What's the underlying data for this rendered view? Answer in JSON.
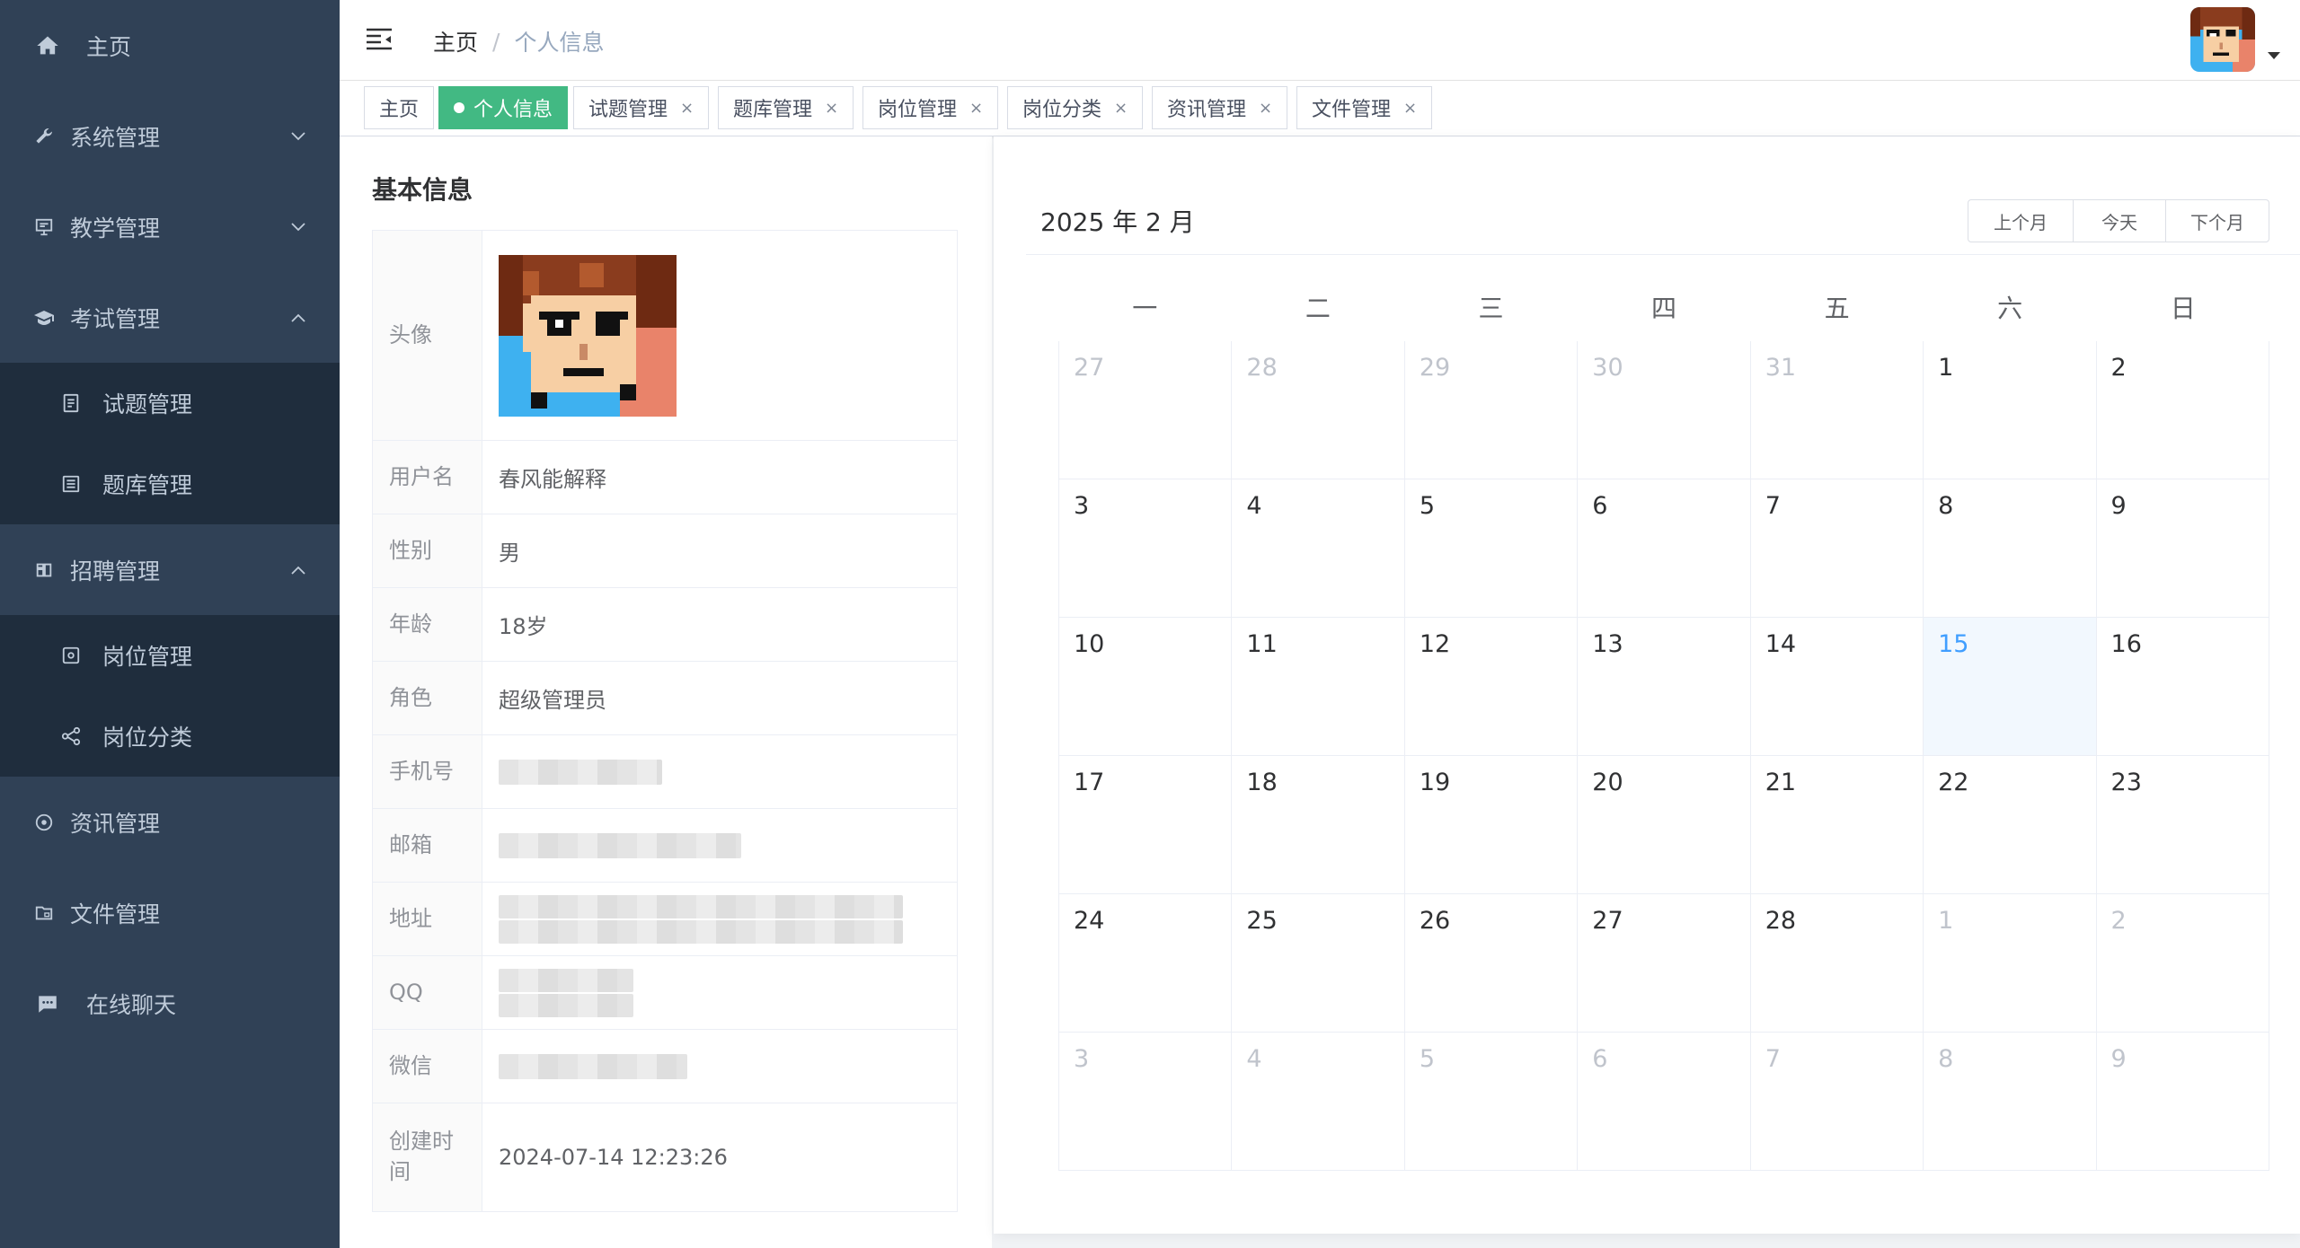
{
  "sidebar": {
    "home": "主页",
    "system": "系统管理",
    "teaching": "教学管理",
    "exam": "考试管理",
    "exam_sub": [
      "试题管理",
      "题库管理"
    ],
    "recruit": "招聘管理",
    "recruit_sub": [
      "岗位管理",
      "岗位分类"
    ],
    "news": "资讯管理",
    "files": "文件管理",
    "chat": "在线聊天"
  },
  "header": {
    "breadcrumb_home": "主页",
    "breadcrumb_sep": "/",
    "breadcrumb_current": "个人信息"
  },
  "tags": [
    {
      "label": "主页",
      "active": false,
      "closable": false
    },
    {
      "label": "个人信息",
      "active": true,
      "closable": false
    },
    {
      "label": "试题管理",
      "active": false,
      "closable": true
    },
    {
      "label": "题库管理",
      "active": false,
      "closable": true
    },
    {
      "label": "岗位管理",
      "active": false,
      "closable": true
    },
    {
      "label": "岗位分类",
      "active": false,
      "closable": true
    },
    {
      "label": "资讯管理",
      "active": false,
      "closable": true
    },
    {
      "label": "文件管理",
      "active": false,
      "closable": true
    }
  ],
  "tag_close_glyph": "×",
  "profile": {
    "title": "基本信息",
    "labels": {
      "avatar": "头像",
      "username": "用户名",
      "gender": "性别",
      "age": "年龄",
      "role": "角色",
      "phone": "手机号",
      "email": "邮箱",
      "address": "地址",
      "qq": "QQ",
      "wechat": "微信",
      "created": "创建时间"
    },
    "values": {
      "username": "春风能解释",
      "gender": "男",
      "age": "18岁",
      "role": "超级管理员",
      "created": "2024-07-14 12:23:26"
    }
  },
  "calendar": {
    "title": "2025 年 2 月",
    "prev": "上个月",
    "today": "今天",
    "next": "下个月",
    "weekdays": [
      "一",
      "二",
      "三",
      "四",
      "五",
      "六",
      "日"
    ],
    "weeks": [
      [
        {
          "d": "27",
          "o": true
        },
        {
          "d": "28",
          "o": true
        },
        {
          "d": "29",
          "o": true
        },
        {
          "d": "30",
          "o": true
        },
        {
          "d": "31",
          "o": true
        },
        {
          "d": "1"
        },
        {
          "d": "2"
        }
      ],
      [
        {
          "d": "3"
        },
        {
          "d": "4"
        },
        {
          "d": "5"
        },
        {
          "d": "6"
        },
        {
          "d": "7"
        },
        {
          "d": "8"
        },
        {
          "d": "9"
        }
      ],
      [
        {
          "d": "10"
        },
        {
          "d": "11"
        },
        {
          "d": "12"
        },
        {
          "d": "13"
        },
        {
          "d": "14"
        },
        {
          "d": "15",
          "t": true
        },
        {
          "d": "16"
        }
      ],
      [
        {
          "d": "17"
        },
        {
          "d": "18"
        },
        {
          "d": "19"
        },
        {
          "d": "20"
        },
        {
          "d": "21"
        },
        {
          "d": "22"
        },
        {
          "d": "23"
        }
      ],
      [
        {
          "d": "24"
        },
        {
          "d": "25"
        },
        {
          "d": "26"
        },
        {
          "d": "27"
        },
        {
          "d": "28"
        },
        {
          "d": "1",
          "o": true
        },
        {
          "d": "2",
          "o": true
        }
      ],
      [
        {
          "d": "3",
          "o": true
        },
        {
          "d": "4",
          "o": true
        },
        {
          "d": "5",
          "o": true
        },
        {
          "d": "6",
          "o": true
        },
        {
          "d": "7",
          "o": true
        },
        {
          "d": "8",
          "o": true
        },
        {
          "d": "9",
          "o": true
        }
      ]
    ]
  },
  "colors": {
    "sidebar_bg": "#304156",
    "submenu_bg": "#1f2d3d",
    "tag_active": "#42b983",
    "today_text": "#409eff"
  }
}
